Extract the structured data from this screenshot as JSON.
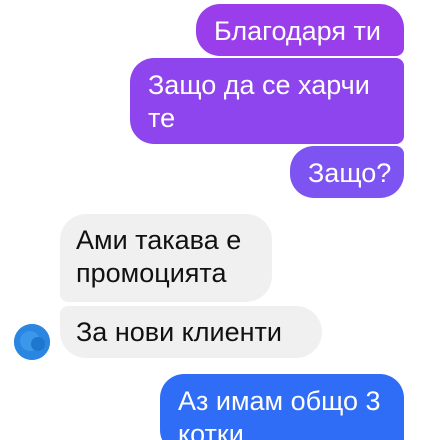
{
  "messages": [
    {
      "lines": [
        "Благодаря ти"
      ],
      "direction": "sent",
      "color": "#9a3dea"
    },
    {
      "lines": [
        "Защо да се харчи",
        "те"
      ],
      "direction": "sent",
      "color": "#8e45ee"
    },
    {
      "lines": [
        "Защо?"
      ],
      "direction": "sent",
      "color": "#7d54f2"
    },
    {
      "lines": [
        "Ами такава е",
        "промоцията"
      ],
      "direction": "received",
      "color": "#f0f0f0"
    },
    {
      "lines": [
        "За нови клиенти"
      ],
      "direction": "received",
      "color": "#f0f0f0"
    },
    {
      "lines": [
        "Аз имам общо 3",
        "котки"
      ],
      "direction": "sent",
      "color": "#2f6df6"
    }
  ],
  "avatar": {
    "icon": "contact-avatar-icon",
    "color": "#2a86e0"
  }
}
